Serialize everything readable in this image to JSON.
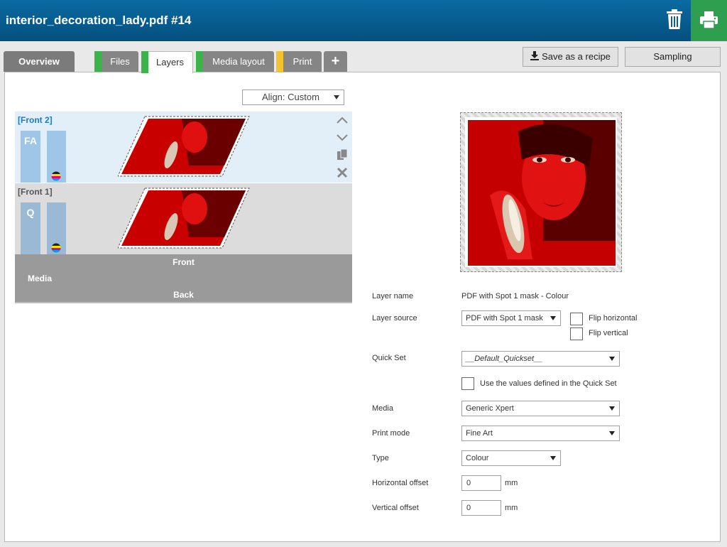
{
  "header": {
    "title": "interior_decoration_lady.pdf #14"
  },
  "tabs": [
    {
      "label": "Overview"
    },
    {
      "label": "Files",
      "stripe": "#3ab34a"
    },
    {
      "label": "Layers",
      "stripe": "#3ab34a"
    },
    {
      "label": "Media layout",
      "stripe": "#3ab34a"
    },
    {
      "label": "Print",
      "stripe": "#f2c230"
    },
    {
      "label": "+"
    }
  ],
  "toolbar": {
    "save_recipe": "Save as a recipe",
    "sampling": "Sampling"
  },
  "align": {
    "value": "Align: Custom"
  },
  "layers": [
    {
      "name": "[Front 2]",
      "badge": "FA"
    },
    {
      "name": "[Front 1]",
      "badge": "Q"
    }
  ],
  "mediabox": {
    "front": "Front",
    "media": "Media",
    "back": "Back"
  },
  "form": {
    "layer_name_label": "Layer name",
    "layer_name_value": "PDF with Spot 1 mask - Colour",
    "layer_source_label": "Layer source",
    "layer_source_value": "PDF with Spot 1 mask",
    "flip_horizontal": "Flip horizontal",
    "flip_vertical": "Flip vertical",
    "quick_set_label": "Quick Set",
    "quick_set_value": "__Default_Quickset__",
    "use_values": "Use the values defined in the Quick Set",
    "media_label": "Media",
    "media_value": "Generic Xpert",
    "print_mode_label": "Print mode",
    "print_mode_value": "Fine Art",
    "type_label": "Type",
    "type_value": "Colour",
    "h_offset_label": "Horizontal offset",
    "h_offset_value": "0",
    "h_offset_unit": "mm",
    "v_offset_label": "Vertical offset",
    "v_offset_value": "0",
    "v_offset_unit": "mm"
  },
  "colors": {
    "header": "#04507d",
    "print_button": "#2e9e4f",
    "active_layer_bg": "#e2eef8",
    "active_layer_text": "#1d7bc7"
  }
}
